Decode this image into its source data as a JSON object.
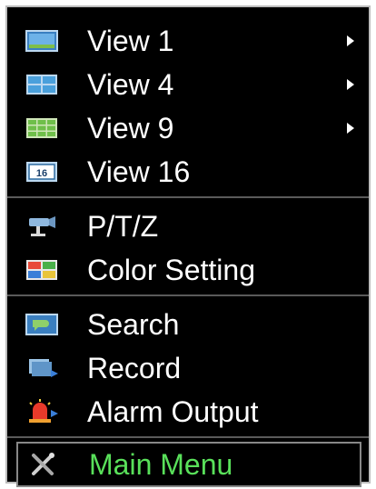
{
  "menu": {
    "groups": [
      {
        "items": [
          {
            "label": "View 1",
            "icon": "view-1-icon",
            "submenu": true
          },
          {
            "label": "View 4",
            "icon": "view-4-icon",
            "submenu": true
          },
          {
            "label": "View 9",
            "icon": "view-9-icon",
            "submenu": true
          },
          {
            "label": "View 16",
            "icon": "view-16-icon",
            "submenu": false
          }
        ]
      },
      {
        "items": [
          {
            "label": "P/T/Z",
            "icon": "ptz-camera-icon",
            "submenu": false
          },
          {
            "label": "Color Setting",
            "icon": "color-setting-icon",
            "submenu": false
          }
        ]
      },
      {
        "items": [
          {
            "label": "Search",
            "icon": "search-icon",
            "submenu": false
          },
          {
            "label": "Record",
            "icon": "record-icon",
            "submenu": false
          },
          {
            "label": "Alarm Output",
            "icon": "alarm-output-icon",
            "submenu": false
          }
        ]
      },
      {
        "items": [
          {
            "label": "Main Menu",
            "icon": "tools-icon",
            "submenu": false,
            "selected": true
          }
        ]
      }
    ],
    "colors": {
      "background": "#000000",
      "text": "#ffffff",
      "selected_text": "#59e05a",
      "separator": "#5a5a5a"
    },
    "view16_badge": "16"
  }
}
